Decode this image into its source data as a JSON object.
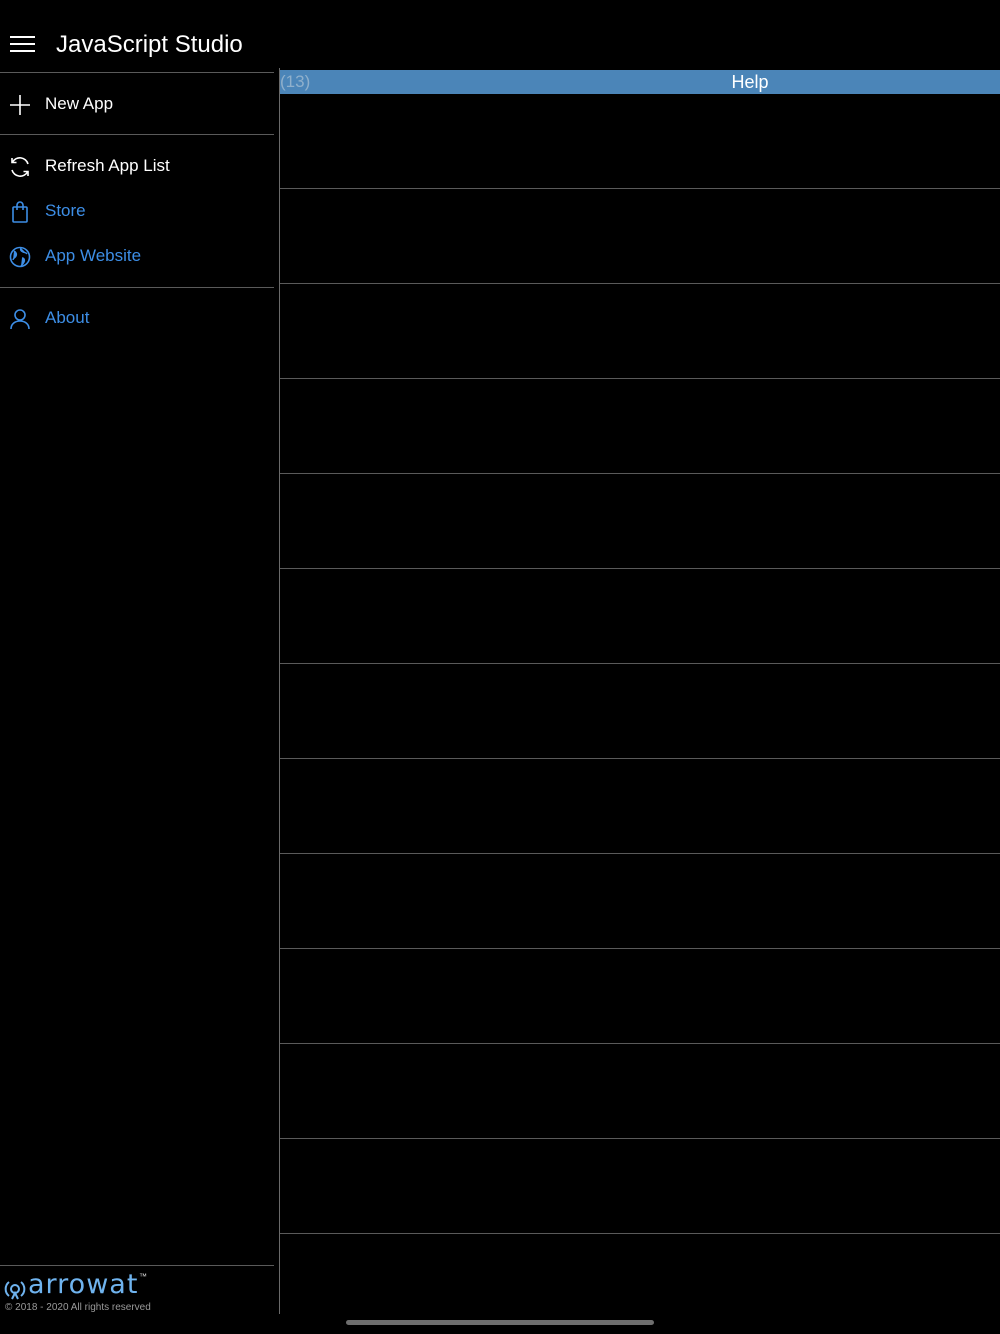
{
  "header": {
    "title": "JavaScript Studio"
  },
  "sidebar": {
    "items": [
      {
        "label": "New App",
        "icon": "plus-icon",
        "color": "#ffffff"
      },
      {
        "label": "Refresh App List",
        "icon": "refresh-icon",
        "color": "#ffffff"
      },
      {
        "label": "Store",
        "icon": "shopping-bag-icon",
        "color": "#3d8ee6"
      },
      {
        "label": "App Website",
        "icon": "globe-icon",
        "color": "#3d8ee6"
      },
      {
        "label": "About",
        "icon": "person-icon",
        "color": "#3d8ee6"
      }
    ],
    "logo": {
      "brand": "arrowat",
      "tm": "™"
    },
    "copyright": "© 2018 - 2020 All rights reserved"
  },
  "main": {
    "help_bar": {
      "count": "(13)",
      "title": "Help",
      "color": "#4b85b8"
    },
    "rows": [
      "",
      "",
      "",
      "",
      "",
      "",
      "",
      "",
      "",
      "",
      "",
      "",
      ""
    ]
  },
  "colors": {
    "accent": "#3d8ee6",
    "background": "#000000"
  }
}
